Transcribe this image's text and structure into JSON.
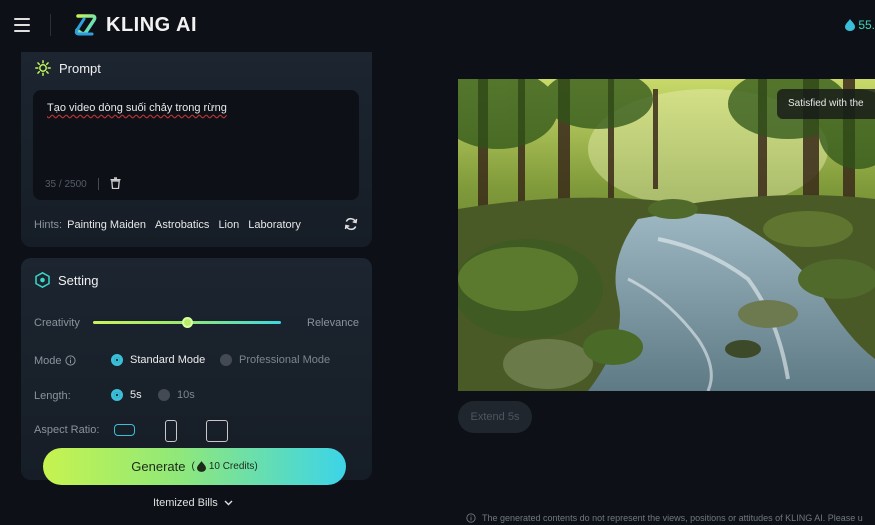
{
  "header": {
    "brand": "KLING AI",
    "credits": "55."
  },
  "prompt": {
    "title": "Prompt",
    "text": "Tạo video dòng suối chảy trong rừng",
    "count": "35 / 2500",
    "hints_label": "Hints:",
    "hints": [
      "Painting Maiden",
      "Astrobatics",
      "Lion",
      "Laboratory"
    ]
  },
  "setting": {
    "title": "Setting",
    "creativity_label": "Creativity",
    "relevance_label": "Relevance",
    "creativity_relevance_value": 0.5,
    "mode_label": "Mode",
    "mode_options": [
      "Standard Mode",
      "Professional Mode"
    ],
    "mode_selected": "Standard Mode",
    "length_label": "Length:",
    "length_options": [
      "5s",
      "10s"
    ],
    "length_selected": "5s",
    "aspect_label": "Aspect Ratio:",
    "aspect_selected": "16:9"
  },
  "generate": {
    "label": "Generate",
    "credits_open": "(",
    "credits": "10 Credits",
    "credits_close": ")"
  },
  "bills_label": "Itemized Bills",
  "preview": {
    "satisfied_text": "Satisfied with the",
    "extend_label": "Extend 5s",
    "disclaimer": "The generated contents do not represent the views, positions or attitudes of KLING AI. Please u"
  },
  "colors": {
    "accent": "#3bbfd8",
    "generate_start": "#c6f34f",
    "generate_end": "#3cd4e8",
    "background": "#0d1117"
  }
}
